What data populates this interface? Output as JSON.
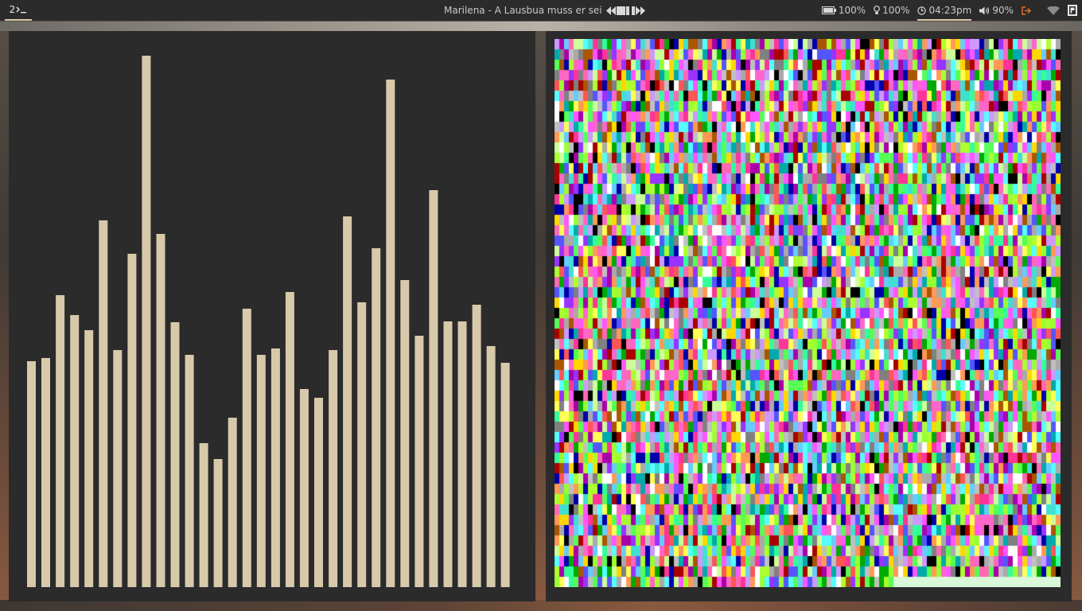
{
  "topbar": {
    "workspace": "2",
    "now_playing": "Marilena - A Lausbua muss er sei",
    "battery": "100%",
    "brightness": "100%",
    "clock": "04:23pm",
    "volume": "90%"
  },
  "visualizer": {
    "bar_color": "#d8c9aa",
    "levels": [
      0.405,
      0.412,
      0.524,
      0.489,
      0.461,
      0.659,
      0.425,
      0.599,
      0.954,
      0.634,
      0.475,
      0.417,
      0.259,
      0.23,
      0.304,
      0.5,
      0.417,
      0.429,
      0.53,
      0.355,
      0.34,
      0.425,
      0.666,
      0.511,
      0.608,
      0.911,
      0.551,
      0.452,
      0.713,
      0.477,
      0.477,
      0.507,
      0.433,
      0.403
    ]
  },
  "noise_panel": {
    "palette": [
      "#ff55ff",
      "#55ff55",
      "#ffffff",
      "#5555ff",
      "#ff5555",
      "#55ffff",
      "#ffff55",
      "#aaaaaa",
      "#000000",
      "#aa00aa",
      "#00aa00",
      "#0000aa",
      "#aa5500",
      "#00aaaa",
      "#aa0000",
      "#ff9955",
      "#99ff33",
      "#ff66cc",
      "#66ccff",
      "#cc99ff",
      "#ccff99",
      "#ff3399",
      "#33ff99",
      "#9933ff",
      "#808080",
      "#c0c0c0",
      "#40e0d0",
      "#ffd700",
      "#adff2f",
      "#ff69b4"
    ],
    "footer_color": "#d9f7d9"
  }
}
